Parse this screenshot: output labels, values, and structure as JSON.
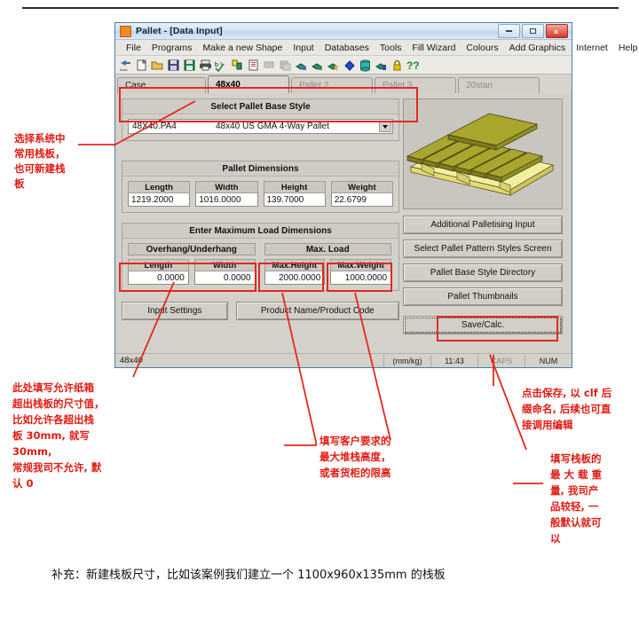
{
  "window": {
    "title": "Pallet - [Data Input]",
    "buttons": {
      "minimize": "–",
      "maximize": "□",
      "close": "×"
    }
  },
  "menubar": {
    "items": [
      "File",
      "Programs",
      "Make a new Shape",
      "Input",
      "Databases",
      "Tools",
      "Fill Wizard",
      "Colours",
      "Add Graphics",
      "Internet",
      "Help"
    ]
  },
  "toolbar": {
    "icons": [
      "back-icon",
      "new-document-icon",
      "open-folder-icon",
      "save-disk-icon",
      "save-green-icon",
      "print-icon",
      "spellcheck-icon",
      "pallet-pattern-icon",
      "report-icon",
      "cut-icon",
      "copy-icon",
      "pallet-load-icon",
      "pallet-load2-icon",
      "pallet-load3-icon",
      "colour-fill-icon",
      "drum-icon",
      "box-stack-icon",
      "lock-icon",
      "help-icon"
    ]
  },
  "tabs": [
    {
      "label": "Case",
      "active": false
    },
    {
      "label": "48x40",
      "active": true
    },
    {
      "label": "Pallet 2",
      "active": false
    },
    {
      "label": "Pallet 3",
      "active": false
    },
    {
      "label": "20stan",
      "active": false
    }
  ],
  "base_style": {
    "header": "Select Pallet Base Style",
    "code": "48X40.PA4",
    "description": "48x40 US GMA 4-Way Pallet"
  },
  "pallet_dimensions": {
    "header": "Pallet Dimensions",
    "fields": [
      {
        "label": "Length",
        "value": "1219.2000"
      },
      {
        "label": "Width",
        "value": "1016.0000"
      },
      {
        "label": "Height",
        "value": "139.7000"
      },
      {
        "label": "Weight",
        "value": "22.6799"
      }
    ]
  },
  "max_load": {
    "header": "Enter Maximum Load Dimensions",
    "overhang_header": "Overhang/Underhang",
    "maxload_header": "Max. Load",
    "fields": [
      {
        "label": "Length",
        "value": "0.0000"
      },
      {
        "label": "Width",
        "value": "0.0000"
      },
      {
        "label": "Max.Height",
        "value": "2000.0000"
      },
      {
        "label": "Max.Weight",
        "value": "1000.0000"
      }
    ]
  },
  "bottom_buttons": {
    "input_settings": "Input Settings",
    "product_name": "Product Name/Product Code"
  },
  "side_buttons": [
    "Additional Palletising Input",
    "Select Pallet Pattern Styles Screen",
    "Pallet Base Style Directory",
    "Pallet Thumbnails"
  ],
  "save_button": "Save/Calc.",
  "preview": {
    "alt": "pallet-3d-preview"
  },
  "statusbar": {
    "left": "48x40",
    "units": "(mm/kg)",
    "time": "11:43",
    "caps": "CAPS",
    "num": "NUM"
  },
  "annotations": {
    "accent_color": "#e11b12",
    "left_top": "选择系统中\n常用栈板，\n也可新建栈\n板",
    "left_bottom": "此处填写允许纸箱\n超出栈板的尺寸值，\n比如允许各超出栈\n板 30mm, 就写 30mm,\n常规我司不允许, 默\n认 0",
    "middle": "填写客户要求的\n最大堆栈高度，\n或者货柜的限高",
    "right_top": "点击保存, 以 clf 后\n缀命名, 后续也可直\n接调用编辑",
    "right_bottom": "填写栈板的\n最 大 载 重\n量, 我司产\n品较轻, 一\n般默认就可\n以",
    "caption": "补充：新建栈板尺寸，比如该案例我们建立一个 1100x960x135mm 的栈板"
  }
}
